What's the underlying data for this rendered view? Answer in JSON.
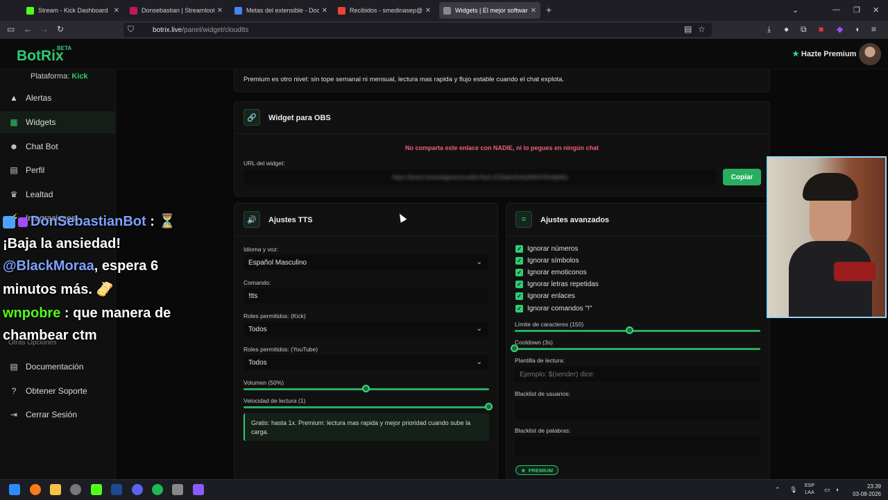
{
  "browser": {
    "tabs": [
      {
        "title": "Stream - Kick Dashboard",
        "color": "#53fc18"
      },
      {
        "title": "Donsebastian | Streamloots | D",
        "color": "#c2185b"
      },
      {
        "title": "Metas del extensible - Documen",
        "color": "#4285f4"
      },
      {
        "title": "Recibidos - smedinasep@gmail",
        "color": "#ea4335"
      },
      {
        "title": "Widgets | El mejor software pa",
        "color": "#888888"
      }
    ],
    "url_host": "botrix.live",
    "url_path": "/panel/widget/cloudtts"
  },
  "app": {
    "logo": "BotRix",
    "beta": "BETA",
    "premium_button": "Hazte Premium"
  },
  "sidebar": {
    "platform_label": "Plataforma:",
    "platform_value": "Kick",
    "items": [
      {
        "label": "Alertas",
        "icon": "warning-icon"
      },
      {
        "label": "Widgets",
        "icon": "widgets-grid-icon"
      },
      {
        "label": "Chat Bot",
        "icon": "robot-icon"
      },
      {
        "label": "Perfil",
        "icon": "profile-card-icon"
      },
      {
        "label": "Lealtad",
        "icon": "trophy-icon"
      },
      {
        "label": "Integraciones",
        "icon": "plug-icon"
      }
    ],
    "section_other": "Otras Opciones",
    "other_items": [
      {
        "label": "Documentación",
        "icon": "doc-icon"
      },
      {
        "label": "Obtener Soporte",
        "icon": "help-icon"
      },
      {
        "label": "Cerrar Sesión",
        "icon": "logout-icon"
      }
    ]
  },
  "main": {
    "premium_note": "Premium es otro nivel: sin tope semanal ni mensual, lectura mas rapida y flujo estable cuando el chat explota.",
    "obs": {
      "title": "Widget para OBS",
      "warning": "No comparta este enlace con NADIE, ni lo pegues en ningún chat",
      "url_label": "URL del widget:",
      "url_value": "https://botrix.live/widgets/cloudtts?bid=Z2Sqkw5oKpWhDV9n8pMQ",
      "copy_button": "Copiar"
    },
    "tts": {
      "title": "Ajustes TTS",
      "lang_label": "Idioma y voz:",
      "lang_value": "Español Masculino",
      "command_label": "Comando:",
      "command_value": "!tts",
      "roles_kick_label": "Roles permitidos: (Kick)",
      "roles_kick_value": "Todos",
      "roles_yt_label": "Roles permitidos: (YouTube)",
      "roles_yt_value": "Todos",
      "volume_label": "Volumen (50%)",
      "volume": 0.5,
      "speed_label": "Velocidad de lectura (1)",
      "speed": 1.0,
      "info": "Gratis: hasta 1x. Premium: lectura mas rapida y mejor prioridad cuando sube la carga."
    },
    "advanced": {
      "title": "Ajustes avanzados",
      "checks": [
        "Ignorar números",
        "Ignorar símbolos",
        "Ignorar emoticonos",
        "Ignorar letras repetidas",
        "Ignorar enlaces",
        "Ignorar comandos \"!\""
      ],
      "char_limit_label": "Límite de caracteres (150)",
      "char_limit": 0.47,
      "cooldown_label": "Cooldown (3s)",
      "cooldown": 0.0,
      "template_label": "Plantilla de lectura:",
      "template_placeholder": "Ejemplo: $(sender) dice:",
      "user_blacklist_label": "Blacklist de usuarios:",
      "word_blacklist_label": "Blacklist de palabras:",
      "premium_badge": "PREMIUM"
    }
  },
  "overlay": {
    "chat": [
      {
        "user": "DonSebastianBot",
        "text": " : ⏳",
        "user_color": "#7ea2ff"
      },
      {
        "text": "¡Baja la ansiedad!"
      },
      {
        "mention": "@BlackMoraa",
        "text": ", espera 6",
        "user_color": "#7ea2ff"
      },
      {
        "text": "minutos más. 🫔"
      },
      {
        "user": "wnpobre",
        "text": " : que manera de",
        "user_color": "#53fc18"
      },
      {
        "text": "chambear ctm"
      }
    ]
  },
  "taskbar": {
    "lang_top": "ESP",
    "lang_bottom": "LAA",
    "time": "23:39",
    "date": "03-08-2026"
  }
}
